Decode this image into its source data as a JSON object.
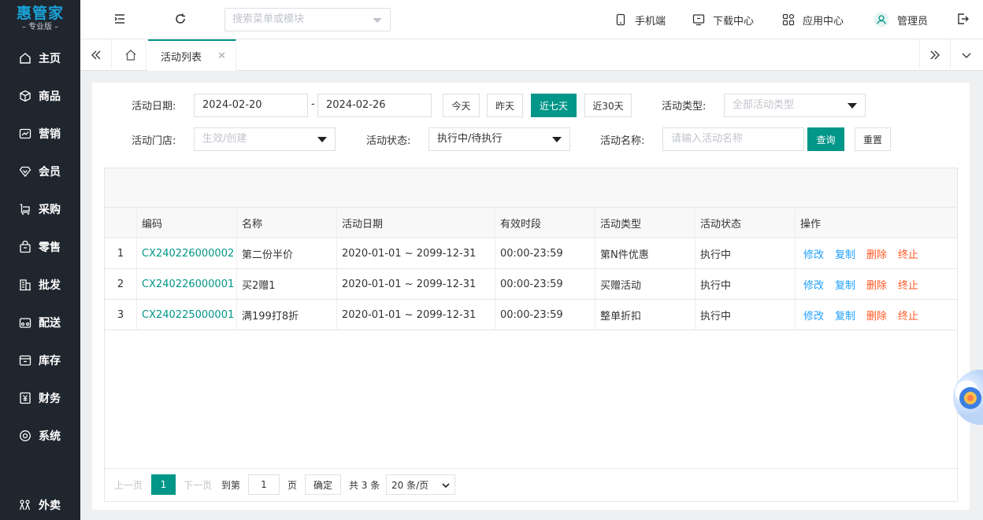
{
  "sidebar": {
    "logo_title": "惠管家",
    "logo_sub": "– 专业版 –",
    "items": [
      {
        "label": "主页",
        "icon": "home-icon"
      },
      {
        "label": "商品",
        "icon": "box-icon"
      },
      {
        "label": "营销",
        "icon": "chart-icon"
      },
      {
        "label": "会员",
        "icon": "diamond-icon"
      },
      {
        "label": "采购",
        "icon": "cart-icon"
      },
      {
        "label": "零售",
        "icon": "bag-icon"
      },
      {
        "label": "批发",
        "icon": "building-icon"
      },
      {
        "label": "配送",
        "icon": "delivery-icon"
      },
      {
        "label": "库存",
        "icon": "storage-icon"
      },
      {
        "label": "财务",
        "icon": "finance-icon"
      },
      {
        "label": "系统",
        "icon": "settings-icon"
      },
      {
        "label": "外卖",
        "icon": "takeout-icon"
      }
    ]
  },
  "topbar": {
    "search_placeholder": "搜索菜单或模块",
    "mobile": "手机端",
    "download": "下载中心",
    "apps": "应用中心",
    "user": "管理员"
  },
  "tabs": {
    "active_label": "活动列表"
  },
  "filters": {
    "date_label": "活动日期:",
    "date_start": "2024-02-20",
    "date_sep": "-",
    "date_end": "2024-02-26",
    "btn_today": "今天",
    "btn_yesterday": "昨天",
    "btn_7days": "近七天",
    "btn_30days": "近30天",
    "type_label": "活动类型:",
    "type_value": "全部活动类型",
    "store_label": "活动门店:",
    "store_value": "生效/创建",
    "status_label": "活动状态:",
    "status_value": "执行中/待执行",
    "name_label": "活动名称:",
    "name_placeholder": "请输入活动名称",
    "btn_query": "查询",
    "btn_reset": "重置"
  },
  "table": {
    "headers": [
      "编码",
      "名称",
      "活动日期",
      "有效时段",
      "活动类型",
      "活动状态",
      "操作"
    ],
    "rows": [
      {
        "idx": "1",
        "code": "CX240226000002",
        "name": "第二份半价",
        "date": "2020-01-01 ~ 2099-12-31",
        "time": "00:00-23:59",
        "type": "第N件优惠",
        "status": "执行中"
      },
      {
        "idx": "2",
        "code": "CX240226000001",
        "name": "买2赠1",
        "date": "2020-01-01 ~ 2099-12-31",
        "time": "00:00-23:59",
        "type": "买赠活动",
        "status": "执行中"
      },
      {
        "idx": "3",
        "code": "CX240225000001",
        "name": "满199打8折",
        "date": "2020-01-01 ~ 2099-12-31",
        "time": "00:00-23:59",
        "type": "整单折扣",
        "status": "执行中"
      }
    ],
    "ops": {
      "edit": "修改",
      "copy": "复制",
      "delete": "删除",
      "stop": "终止"
    }
  },
  "pager": {
    "prev": "上一页",
    "current": "1",
    "next": "下一页",
    "goto_label": "到第",
    "goto_value": "1",
    "page_unit": "页",
    "confirm": "确定",
    "total": "共 3 条",
    "page_size": "20 条/页"
  },
  "colors": {
    "accent": "#009688",
    "sidebar_bg": "#1f262e",
    "link_blue": "#1e9fff",
    "danger": "#ff5722"
  }
}
